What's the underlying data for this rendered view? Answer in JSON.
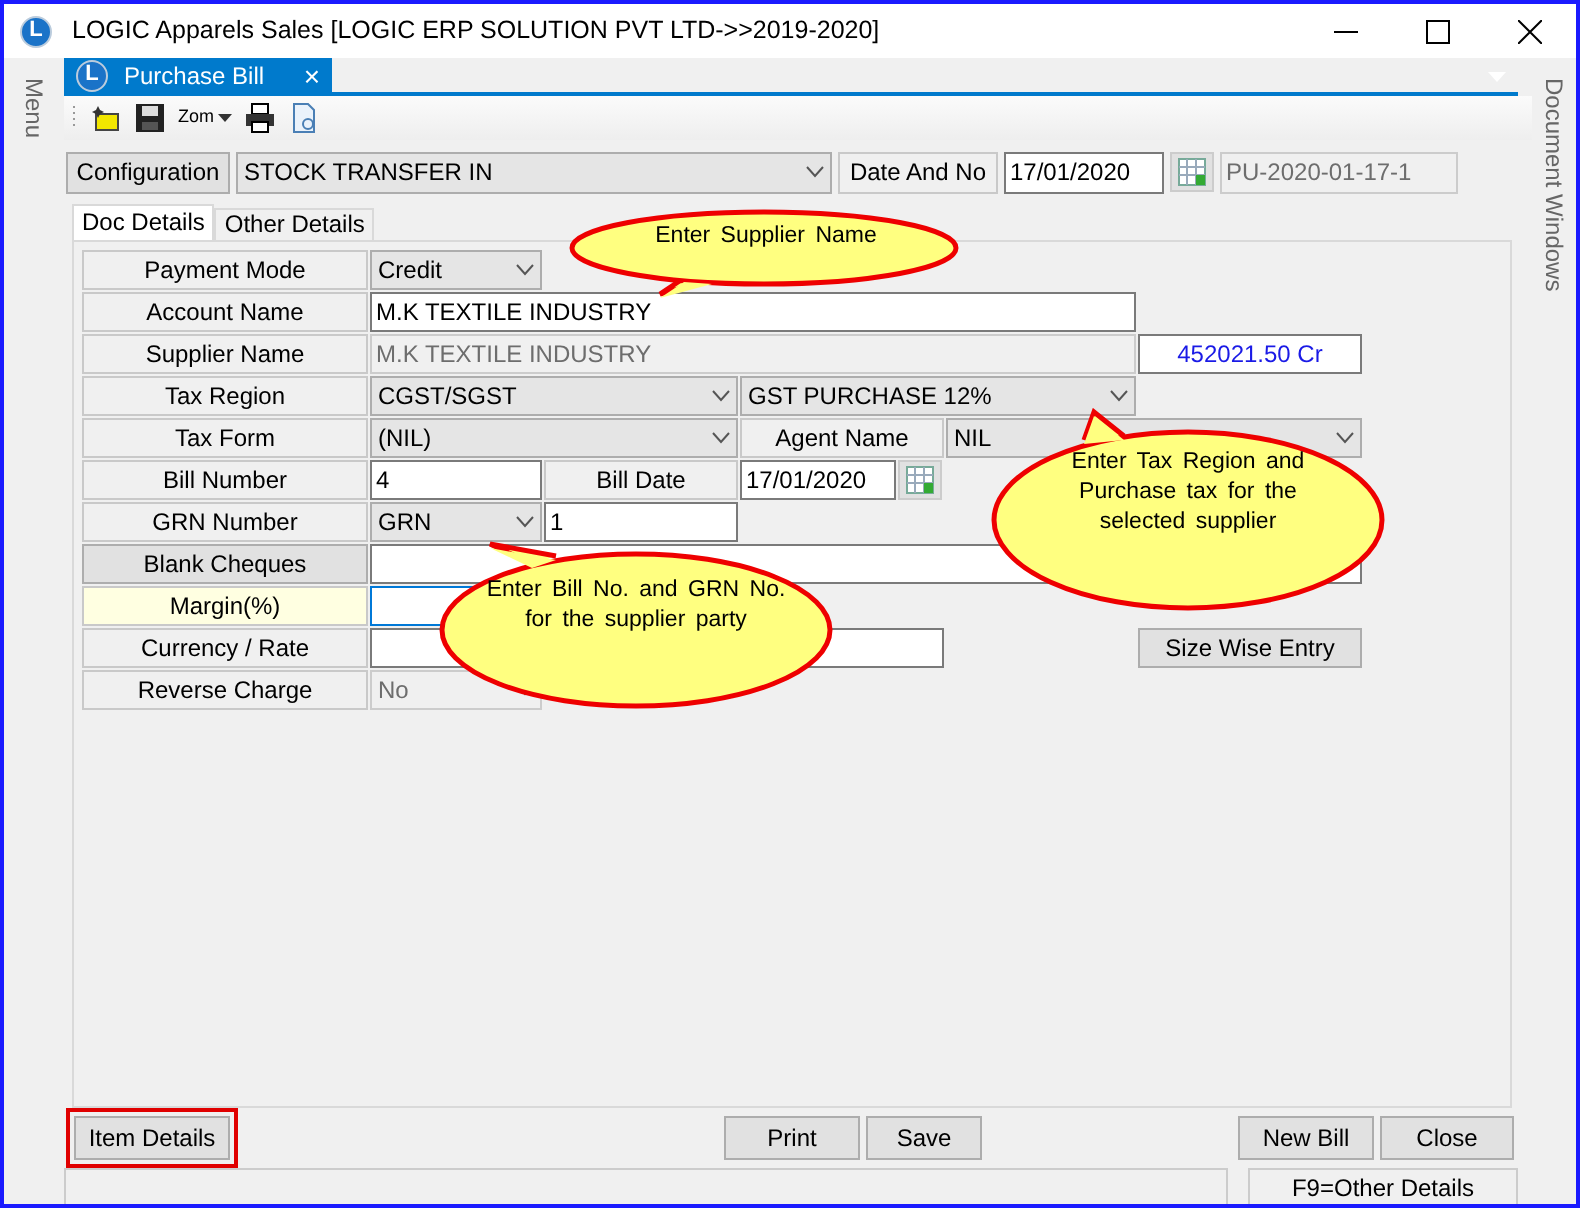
{
  "window": {
    "icon_letter": "L",
    "title": "LOGIC Apparels Sales  [LOGIC ERP SOLUTION PVT LTD->>2019-2020]"
  },
  "side_panels": {
    "left": "Menu",
    "right": "Document Windows"
  },
  "document_tab": {
    "icon_letter": "L",
    "label": "Purchase Bill",
    "close": "×"
  },
  "toolbar": [
    {
      "kind": "new"
    },
    {
      "kind": "save"
    },
    {
      "kind": "zoom",
      "label": "Zom"
    },
    {
      "kind": "print"
    },
    {
      "kind": "preview"
    }
  ],
  "configuration": {
    "label": "Configuration",
    "value": "STOCK TRANSFER IN",
    "date_label": "Date And No",
    "date": "17/01/2020",
    "number": "PU-2020-01-17-1"
  },
  "tabs": [
    {
      "label": "Doc Details",
      "selected": true
    },
    {
      "label": "Other Details",
      "selected": false
    }
  ],
  "form_rows": [
    {
      "label": "Payment Mode",
      "kind": "plain",
      "cells": [
        {
          "kind": "select",
          "text": "Credit"
        }
      ]
    },
    {
      "label": "Account Name",
      "kind": "plain",
      "cells": [
        {
          "kind": "input",
          "text": "M.K TEXTILE INDUSTRY"
        }
      ]
    },
    {
      "label": "Supplier Name",
      "kind": "plain",
      "cells": [
        {
          "kind": "disabled",
          "text": "M.K TEXTILE INDUSTRY"
        },
        {
          "kind": "amount",
          "text": "452021.50 Cr"
        }
      ]
    },
    {
      "label": "Tax Region",
      "kind": "plain",
      "cells": [
        {
          "kind": "select",
          "text": "CGST/SGST"
        },
        {
          "kind": "select",
          "text": "GST PURCHASE 12%"
        }
      ]
    },
    {
      "label": "Tax Form",
      "kind": "plain",
      "cells": [
        {
          "kind": "select",
          "text": "(NIL)"
        },
        {
          "kind": "label",
          "text": "Agent Name"
        },
        {
          "kind": "select",
          "text": "NIL"
        }
      ]
    },
    {
      "label": "Bill Number",
      "kind": "plain",
      "cells": [
        {
          "kind": "input",
          "text": "4"
        },
        {
          "kind": "label",
          "text": "Bill Date"
        },
        {
          "kind": "input",
          "text": "17/01/2020"
        },
        {
          "kind": "calendar"
        }
      ]
    },
    {
      "label": "GRN Number",
      "kind": "plain",
      "cells": [
        {
          "kind": "select",
          "text": "GRN"
        },
        {
          "kind": "input",
          "text": "1"
        }
      ]
    },
    {
      "label": "Blank Cheques",
      "kind": "button",
      "cells": [
        {
          "kind": "input",
          "text": ""
        }
      ]
    },
    {
      "label": "Margin(%)",
      "kind": "highlight",
      "cells": [
        {
          "kind": "focused",
          "text": ""
        }
      ]
    },
    {
      "label": "Currency / Rate",
      "kind": "plain",
      "cells": [
        {
          "kind": "input",
          "text": ""
        },
        {
          "kind": "button",
          "text": "Size Wise Entry"
        }
      ]
    },
    {
      "label": "Reverse Charge",
      "kind": "plain",
      "cells": [
        {
          "kind": "disabled-select",
          "text": "No"
        }
      ]
    }
  ],
  "callouts": [
    {
      "text": "Enter  Supplier  Name"
    },
    {
      "text": "Enter  Bill  No.  and  GRN  No.  for  the  supplier party"
    },
    {
      "text": "Enter  Tax  Region  and  Purchase  tax  for  the  selected  supplier"
    }
  ],
  "bottom_buttons": [
    {
      "label": "Item Details",
      "highlighted": true
    },
    {
      "label": "Print",
      "highlighted": false
    },
    {
      "label": "Save",
      "highlighted": false
    },
    {
      "label": "New Bill",
      "highlighted": false
    },
    {
      "label": "Close",
      "highlighted": false
    }
  ],
  "status": "F9=Other Details"
}
